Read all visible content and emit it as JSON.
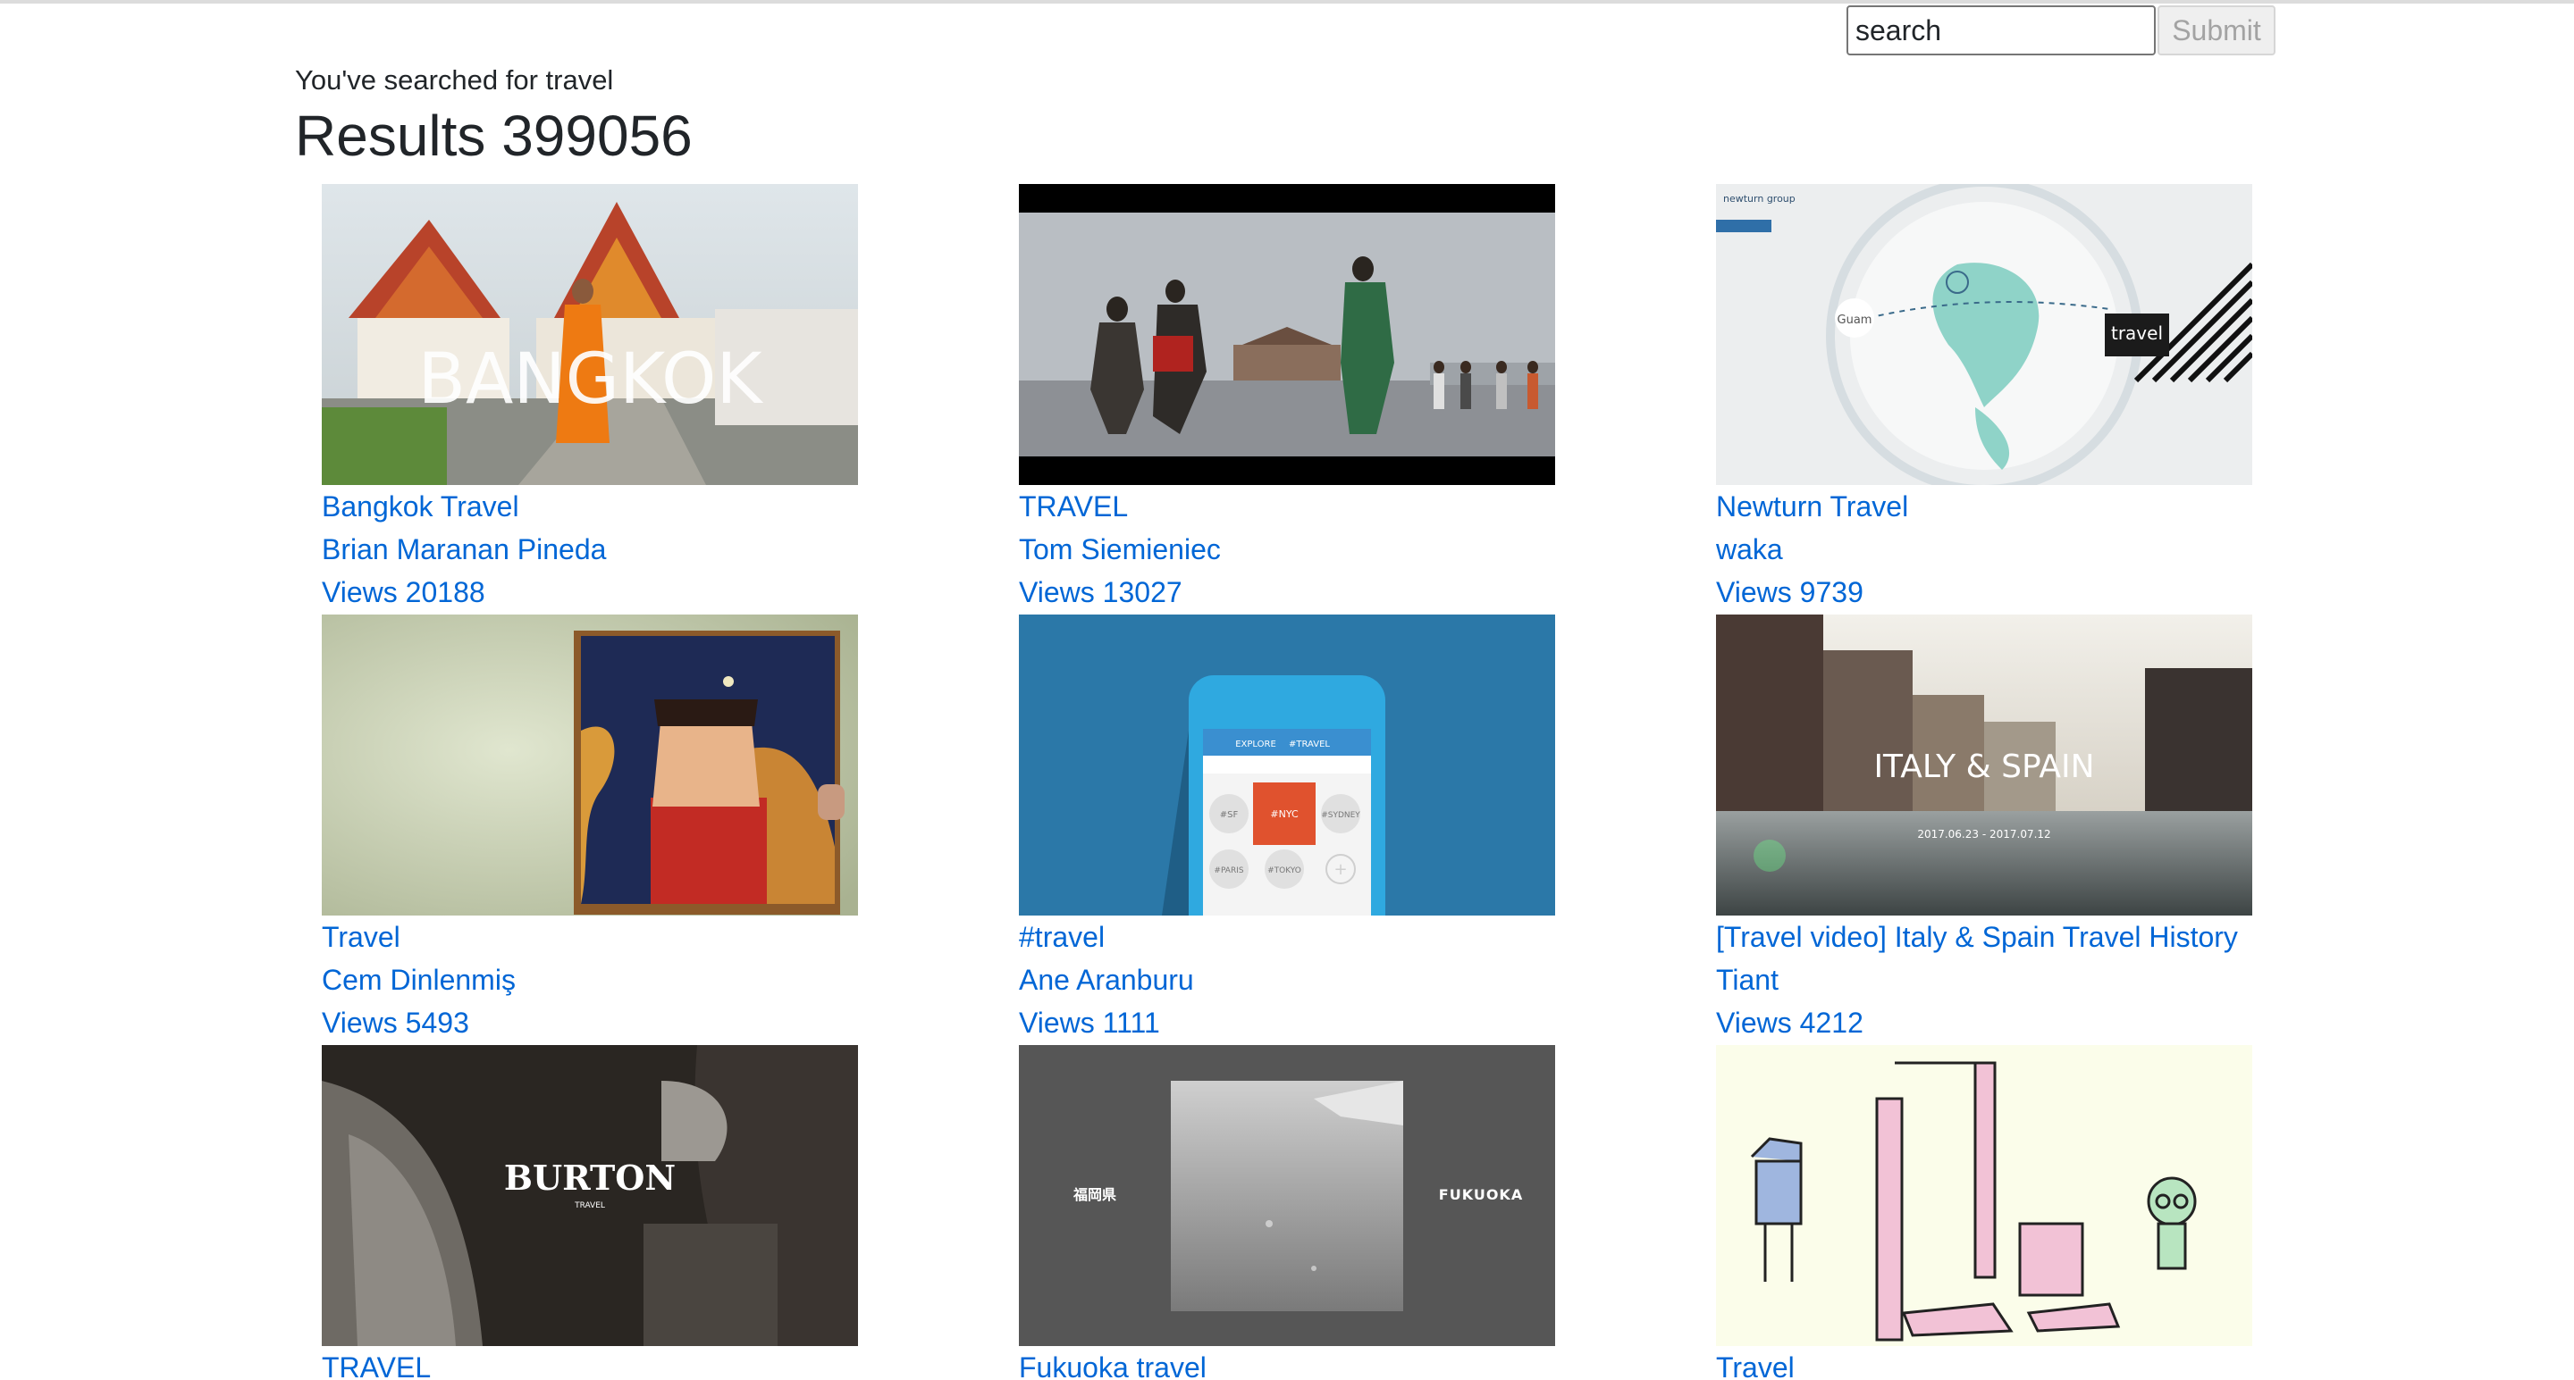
{
  "search": {
    "placeholder": "search",
    "value": "",
    "submit_label": "Submit"
  },
  "header": {
    "searched_text": "You've searched for travel",
    "results_text": "Results 399056"
  },
  "results": [
    {
      "title": "Bangkok Travel",
      "author": "Brian Maranan Pineda",
      "views": "Views 20188",
      "thumb_text": "BANGKOK"
    },
    {
      "title": "TRAVEL",
      "author": "Tom Siemieniec",
      "views": "Views 13027",
      "thumb_text": ""
    },
    {
      "title": "Newturn Travel",
      "author": "waka",
      "views": "Views 9739",
      "thumb_text": "travel",
      "thumb_brand": "newturn group",
      "thumb_city": "Guam"
    },
    {
      "title": "Travel",
      "author": "Cem Dinlenmiş",
      "views": "Views 5493",
      "thumb_text": ""
    },
    {
      "title": "#travel",
      "author": "Ane Aranburu",
      "views": "Views 1111",
      "thumb_text": "#NYC",
      "thumb_tags": [
        "#SF",
        "#SYDNEY",
        "#PARIS",
        "#TOKYO"
      ],
      "thumb_tabs": [
        "EXPLORE",
        "#TRAVEL"
      ]
    },
    {
      "title": "[Travel video] Italy & Spain Travel History",
      "author": "Tiant",
      "views": "Views 4212",
      "thumb_text": "ITALY & SPAIN",
      "thumb_sub": "2017.06.23 - 2017.07.12"
    },
    {
      "title": "TRAVEL",
      "author": "",
      "views": "",
      "thumb_text": "BURTON",
      "thumb_sub": "TRAVEL"
    },
    {
      "title": "Fukuoka travel",
      "author": "",
      "views": "",
      "thumb_text": "FUKUOKA",
      "thumb_sub": "福岡県"
    },
    {
      "title": "Travel",
      "author": "",
      "views": "",
      "thumb_text": ""
    }
  ],
  "colors": {
    "link": "#0066d6",
    "text": "#212529",
    "border_top": "#dcdcdc"
  }
}
